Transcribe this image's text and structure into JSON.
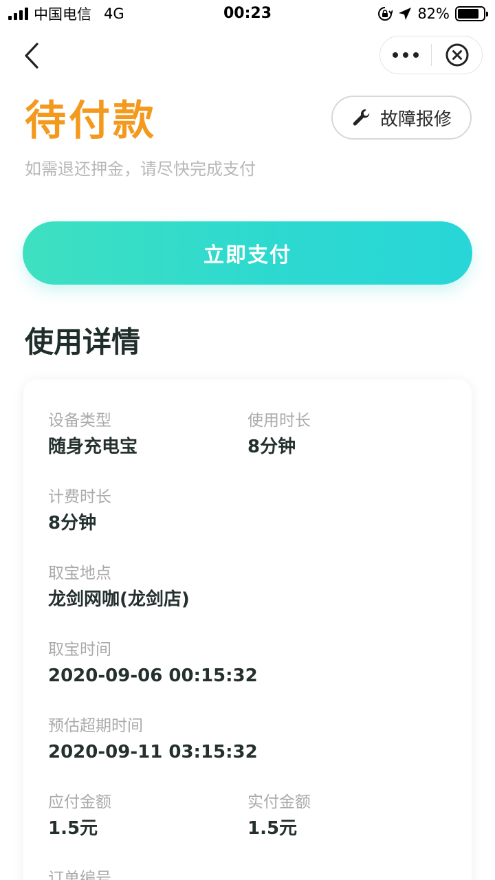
{
  "status_bar": {
    "carrier": "中国电信",
    "network": "4G",
    "time": "00:23",
    "battery_percent": "82%",
    "battery_level": 0.82
  },
  "nav": {
    "back_icon": "chevron-left-icon",
    "more_icon": "more-dots-icon",
    "close_icon": "close-circle-icon"
  },
  "header": {
    "title": "待付款",
    "subtitle": "如需退还押金，请尽快完成支付",
    "repair_label": "故障报修",
    "repair_icon": "wrench-icon"
  },
  "pay_button": {
    "label": "立即支付"
  },
  "details": {
    "title": "使用详情",
    "device_type": {
      "label": "设备类型",
      "value": "随身充电宝"
    },
    "usage_duration": {
      "label": "使用时长",
      "value": "8分钟"
    },
    "billing_duration": {
      "label": "计费时长",
      "value": "8分钟"
    },
    "pickup_location": {
      "label": "取宝地点",
      "value": "龙剑网咖(龙剑店)"
    },
    "pickup_time": {
      "label": "取宝时间",
      "value": "2020-09-06 00:15:32"
    },
    "estimated_overdue_time": {
      "label": "预估超期时间",
      "value": "2020-09-11 03:15:32"
    },
    "amount_due": {
      "label": "应付金额",
      "value": "1.5元"
    },
    "amount_paid": {
      "label": "实付金额",
      "value": "1.5元"
    },
    "order_number": {
      "label": "订单编号"
    }
  },
  "colors": {
    "title_orange": "#f39a1e",
    "pay_gradient_start": "#3ee0c0",
    "pay_gradient_end": "#28d6d8",
    "label_gray": "#aaaaaa",
    "value_dark": "#24302e"
  }
}
